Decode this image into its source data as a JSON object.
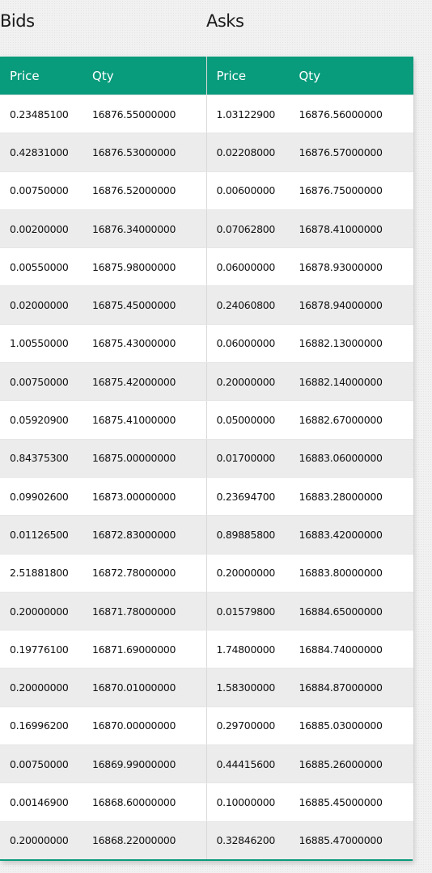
{
  "bids": {
    "title": "Bids",
    "headers": {
      "price": "Price",
      "qty": "Qty"
    },
    "rows": [
      {
        "price": "0.23485100",
        "qty": "16876.55000000"
      },
      {
        "price": "0.42831000",
        "qty": "16876.53000000"
      },
      {
        "price": "0.00750000",
        "qty": "16876.52000000"
      },
      {
        "price": "0.00200000",
        "qty": "16876.34000000"
      },
      {
        "price": "0.00550000",
        "qty": "16875.98000000"
      },
      {
        "price": "0.02000000",
        "qty": "16875.45000000"
      },
      {
        "price": "1.00550000",
        "qty": "16875.43000000"
      },
      {
        "price": "0.00750000",
        "qty": "16875.42000000"
      },
      {
        "price": "0.05920900",
        "qty": "16875.41000000"
      },
      {
        "price": "0.84375300",
        "qty": "16875.00000000"
      },
      {
        "price": "0.09902600",
        "qty": "16873.00000000"
      },
      {
        "price": "0.01126500",
        "qty": "16872.83000000"
      },
      {
        "price": "2.51881800",
        "qty": "16872.78000000"
      },
      {
        "price": "0.20000000",
        "qty": "16871.78000000"
      },
      {
        "price": "0.19776100",
        "qty": "16871.69000000"
      },
      {
        "price": "0.20000000",
        "qty": "16870.01000000"
      },
      {
        "price": "0.16996200",
        "qty": "16870.00000000"
      },
      {
        "price": "0.00750000",
        "qty": "16869.99000000"
      },
      {
        "price": "0.00146900",
        "qty": "16868.60000000"
      },
      {
        "price": "0.20000000",
        "qty": "16868.22000000"
      }
    ]
  },
  "asks": {
    "title": "Asks",
    "headers": {
      "price": "Price",
      "qty": "Qty"
    },
    "rows": [
      {
        "price": "1.03122900",
        "qty": "16876.56000000"
      },
      {
        "price": "0.02208000",
        "qty": "16876.57000000"
      },
      {
        "price": "0.00600000",
        "qty": "16876.75000000"
      },
      {
        "price": "0.07062800",
        "qty": "16878.41000000"
      },
      {
        "price": "0.06000000",
        "qty": "16878.93000000"
      },
      {
        "price": "0.24060800",
        "qty": "16878.94000000"
      },
      {
        "price": "0.06000000",
        "qty": "16882.13000000"
      },
      {
        "price": "0.20000000",
        "qty": "16882.14000000"
      },
      {
        "price": "0.05000000",
        "qty": "16882.67000000"
      },
      {
        "price": "0.01700000",
        "qty": "16883.06000000"
      },
      {
        "price": "0.23694700",
        "qty": "16883.28000000"
      },
      {
        "price": "0.89885800",
        "qty": "16883.42000000"
      },
      {
        "price": "0.20000000",
        "qty": "16883.80000000"
      },
      {
        "price": "0.01579800",
        "qty": "16884.65000000"
      },
      {
        "price": "1.74800000",
        "qty": "16884.74000000"
      },
      {
        "price": "1.58300000",
        "qty": "16884.87000000"
      },
      {
        "price": "0.29700000",
        "qty": "16885.03000000"
      },
      {
        "price": "0.44415600",
        "qty": "16885.26000000"
      },
      {
        "price": "0.10000000",
        "qty": "16885.45000000"
      },
      {
        "price": "0.32846200",
        "qty": "16885.47000000"
      }
    ]
  },
  "colors": {
    "header_bg": "#089b7c",
    "header_text": "#ffffff",
    "row_odd": "#ffffff",
    "row_even": "#ececec"
  }
}
